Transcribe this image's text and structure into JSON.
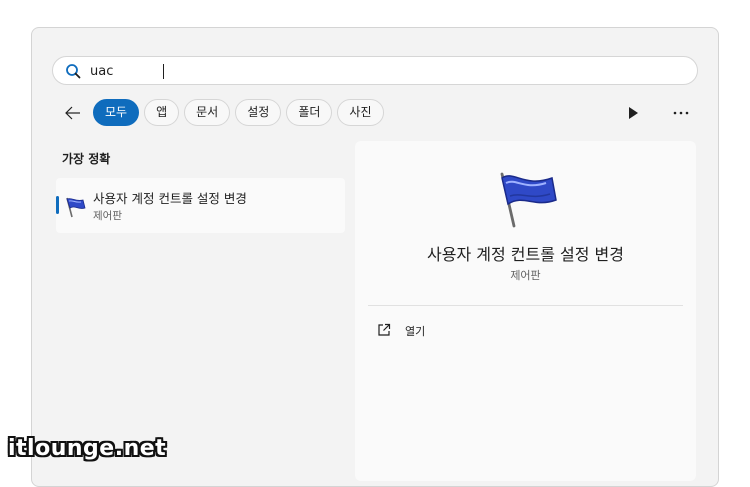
{
  "search": {
    "value": "uac",
    "icon": "search-icon"
  },
  "nav": {
    "back_icon": "arrow-left-icon"
  },
  "filters": [
    {
      "label": "모두",
      "active": true
    },
    {
      "label": "앱",
      "active": false
    },
    {
      "label": "문서",
      "active": false
    },
    {
      "label": "설정",
      "active": false
    },
    {
      "label": "폴더",
      "active": false
    },
    {
      "label": "사진",
      "active": false
    }
  ],
  "toolbar": {
    "play_icon": "play-icon",
    "more_icon": "more-icon"
  },
  "best_match": {
    "heading": "가장 정확",
    "title": "사용자 계정 컨트롤 설정 변경",
    "subtitle": "제어판",
    "icon": "flag-icon"
  },
  "detail": {
    "title": "사용자 계정 컨트롤 설정 변경",
    "subtitle": "제어판",
    "icon": "flag-icon",
    "actions": [
      {
        "label": "열기",
        "icon": "open-external-icon"
      }
    ]
  },
  "watermark": "itlounge.net",
  "colors": {
    "accent": "#0f6cbd",
    "panel_bg": "#f3f3f3"
  }
}
